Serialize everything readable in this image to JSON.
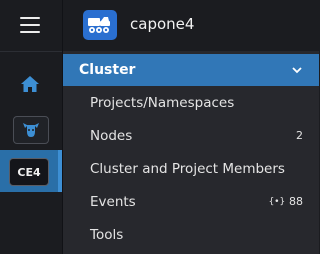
{
  "app": {
    "cluster_name": "capone4"
  },
  "rail": {
    "active_cluster_abbr": "CE4"
  },
  "nav": {
    "section_label": "Cluster",
    "items": [
      {
        "label": "Projects/Namespaces",
        "count": ""
      },
      {
        "label": "Nodes",
        "count": "2"
      },
      {
        "label": "Cluster and Project Members",
        "count": ""
      },
      {
        "label": "Events",
        "count": "88",
        "badge_glyph": "{•}"
      },
      {
        "label": "Tools",
        "count": ""
      }
    ]
  },
  "colors": {
    "accent": "#3177b7",
    "rail_active": "#2a6fa8",
    "logo": "#2a6fd0"
  }
}
